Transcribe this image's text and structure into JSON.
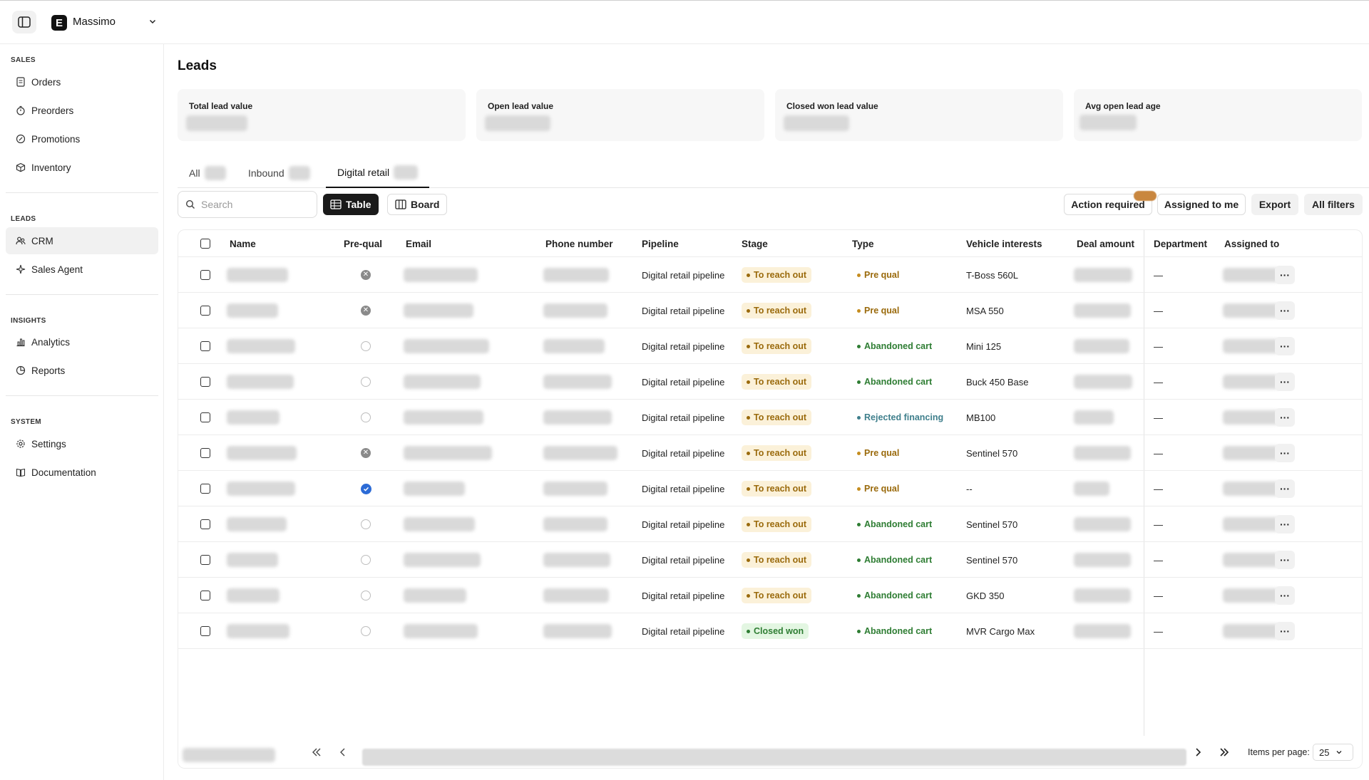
{
  "app": {
    "workspace_name": "Massimo",
    "logo_letter": "E"
  },
  "sidebar": {
    "sections": [
      {
        "title": "SALES",
        "items": [
          {
            "label": "Orders",
            "icon": "document-icon"
          },
          {
            "label": "Preorders",
            "icon": "stopwatch-icon"
          },
          {
            "label": "Promotions",
            "icon": "percent-icon"
          },
          {
            "label": "Inventory",
            "icon": "box-icon"
          }
        ]
      },
      {
        "title": "LEADS",
        "items": [
          {
            "label": "CRM",
            "icon": "users-icon",
            "active": true
          },
          {
            "label": "Sales Agent",
            "icon": "sparkle-icon"
          }
        ]
      },
      {
        "title": "INSIGHTS",
        "items": [
          {
            "label": "Analytics",
            "icon": "bar-chart-icon"
          },
          {
            "label": "Reports",
            "icon": "pie-chart-icon"
          }
        ]
      },
      {
        "title": "SYSTEM",
        "items": [
          {
            "label": "Settings",
            "icon": "gear-icon"
          },
          {
            "label": "Documentation",
            "icon": "book-icon"
          }
        ]
      }
    ]
  },
  "page": {
    "title": "Leads",
    "stats": [
      {
        "label": "Total lead value"
      },
      {
        "label": "Open lead value"
      },
      {
        "label": "Closed won lead value"
      },
      {
        "label": "Avg open lead age"
      }
    ],
    "tabs": [
      {
        "label": "All",
        "active": false
      },
      {
        "label": "Inbound",
        "active": false
      },
      {
        "label": "Digital retail",
        "active": true
      }
    ],
    "search_placeholder": "Search",
    "views": {
      "table": "Table",
      "board": "Board"
    },
    "toolbar": {
      "action_required": "Action required",
      "assigned_to_me": "Assigned to me",
      "export": "Export",
      "all_filters": "All filters"
    }
  },
  "table": {
    "columns": [
      "Name",
      "Pre-qual",
      "Email",
      "Phone number",
      "Pipeline",
      "Stage",
      "Type",
      "Vehicle interests",
      "Deal amount",
      "Department",
      "Assigned to"
    ],
    "rows": [
      {
        "prequal": "x",
        "pipeline": "Digital retail pipeline",
        "stage": "To reach out",
        "type": "Pre qual",
        "vehicle": "T-Boss 560L",
        "department": "—"
      },
      {
        "prequal": "x",
        "pipeline": "Digital retail pipeline",
        "stage": "To reach out",
        "type": "Pre qual",
        "vehicle": "MSA 550",
        "department": "—"
      },
      {
        "prequal": "empty",
        "pipeline": "Digital retail pipeline",
        "stage": "To reach out",
        "type": "Abandoned cart",
        "vehicle": "Mini 125",
        "department": "—"
      },
      {
        "prequal": "empty",
        "pipeline": "Digital retail pipeline",
        "stage": "To reach out",
        "type": "Abandoned cart",
        "vehicle": "Buck 450 Base",
        "department": "—"
      },
      {
        "prequal": "empty",
        "pipeline": "Digital retail pipeline",
        "stage": "To reach out",
        "type": "Rejected financing",
        "vehicle": "MB100",
        "department": "—"
      },
      {
        "prequal": "x",
        "pipeline": "Digital retail pipeline",
        "stage": "To reach out",
        "type": "Pre qual",
        "vehicle": "Sentinel 570",
        "department": "—"
      },
      {
        "prequal": "check",
        "pipeline": "Digital retail pipeline",
        "stage": "To reach out",
        "type": "Pre qual",
        "vehicle": "--",
        "department": "—"
      },
      {
        "prequal": "empty",
        "pipeline": "Digital retail pipeline",
        "stage": "To reach out",
        "type": "Abandoned cart",
        "vehicle": "Sentinel 570",
        "department": "—"
      },
      {
        "prequal": "empty",
        "pipeline": "Digital retail pipeline",
        "stage": "To reach out",
        "type": "Abandoned cart",
        "vehicle": "Sentinel 570",
        "department": "—"
      },
      {
        "prequal": "empty",
        "pipeline": "Digital retail pipeline",
        "stage": "To reach out",
        "type": "Abandoned cart",
        "vehicle": "GKD 350",
        "department": "—"
      },
      {
        "prequal": "empty",
        "pipeline": "Digital retail pipeline",
        "stage": "Closed won",
        "type": "Abandoned cart",
        "vehicle": "MVR Cargo Max",
        "department": "—"
      }
    ],
    "more_label": "···"
  },
  "pagination": {
    "items_per_page_label": "Items per page:",
    "items_per_page_value": "25"
  },
  "colors": {
    "stage_to_reach_out": "#9a6a0c",
    "stage_closed_won": "#2e7d33",
    "type_pre_qual": "#9a6a0c",
    "type_abandoned_cart": "#2e7d33",
    "type_rejected_financing": "#3f7f8c",
    "prequal_checked": "#2c6bd6",
    "action_required_badge": "#c9873f"
  }
}
